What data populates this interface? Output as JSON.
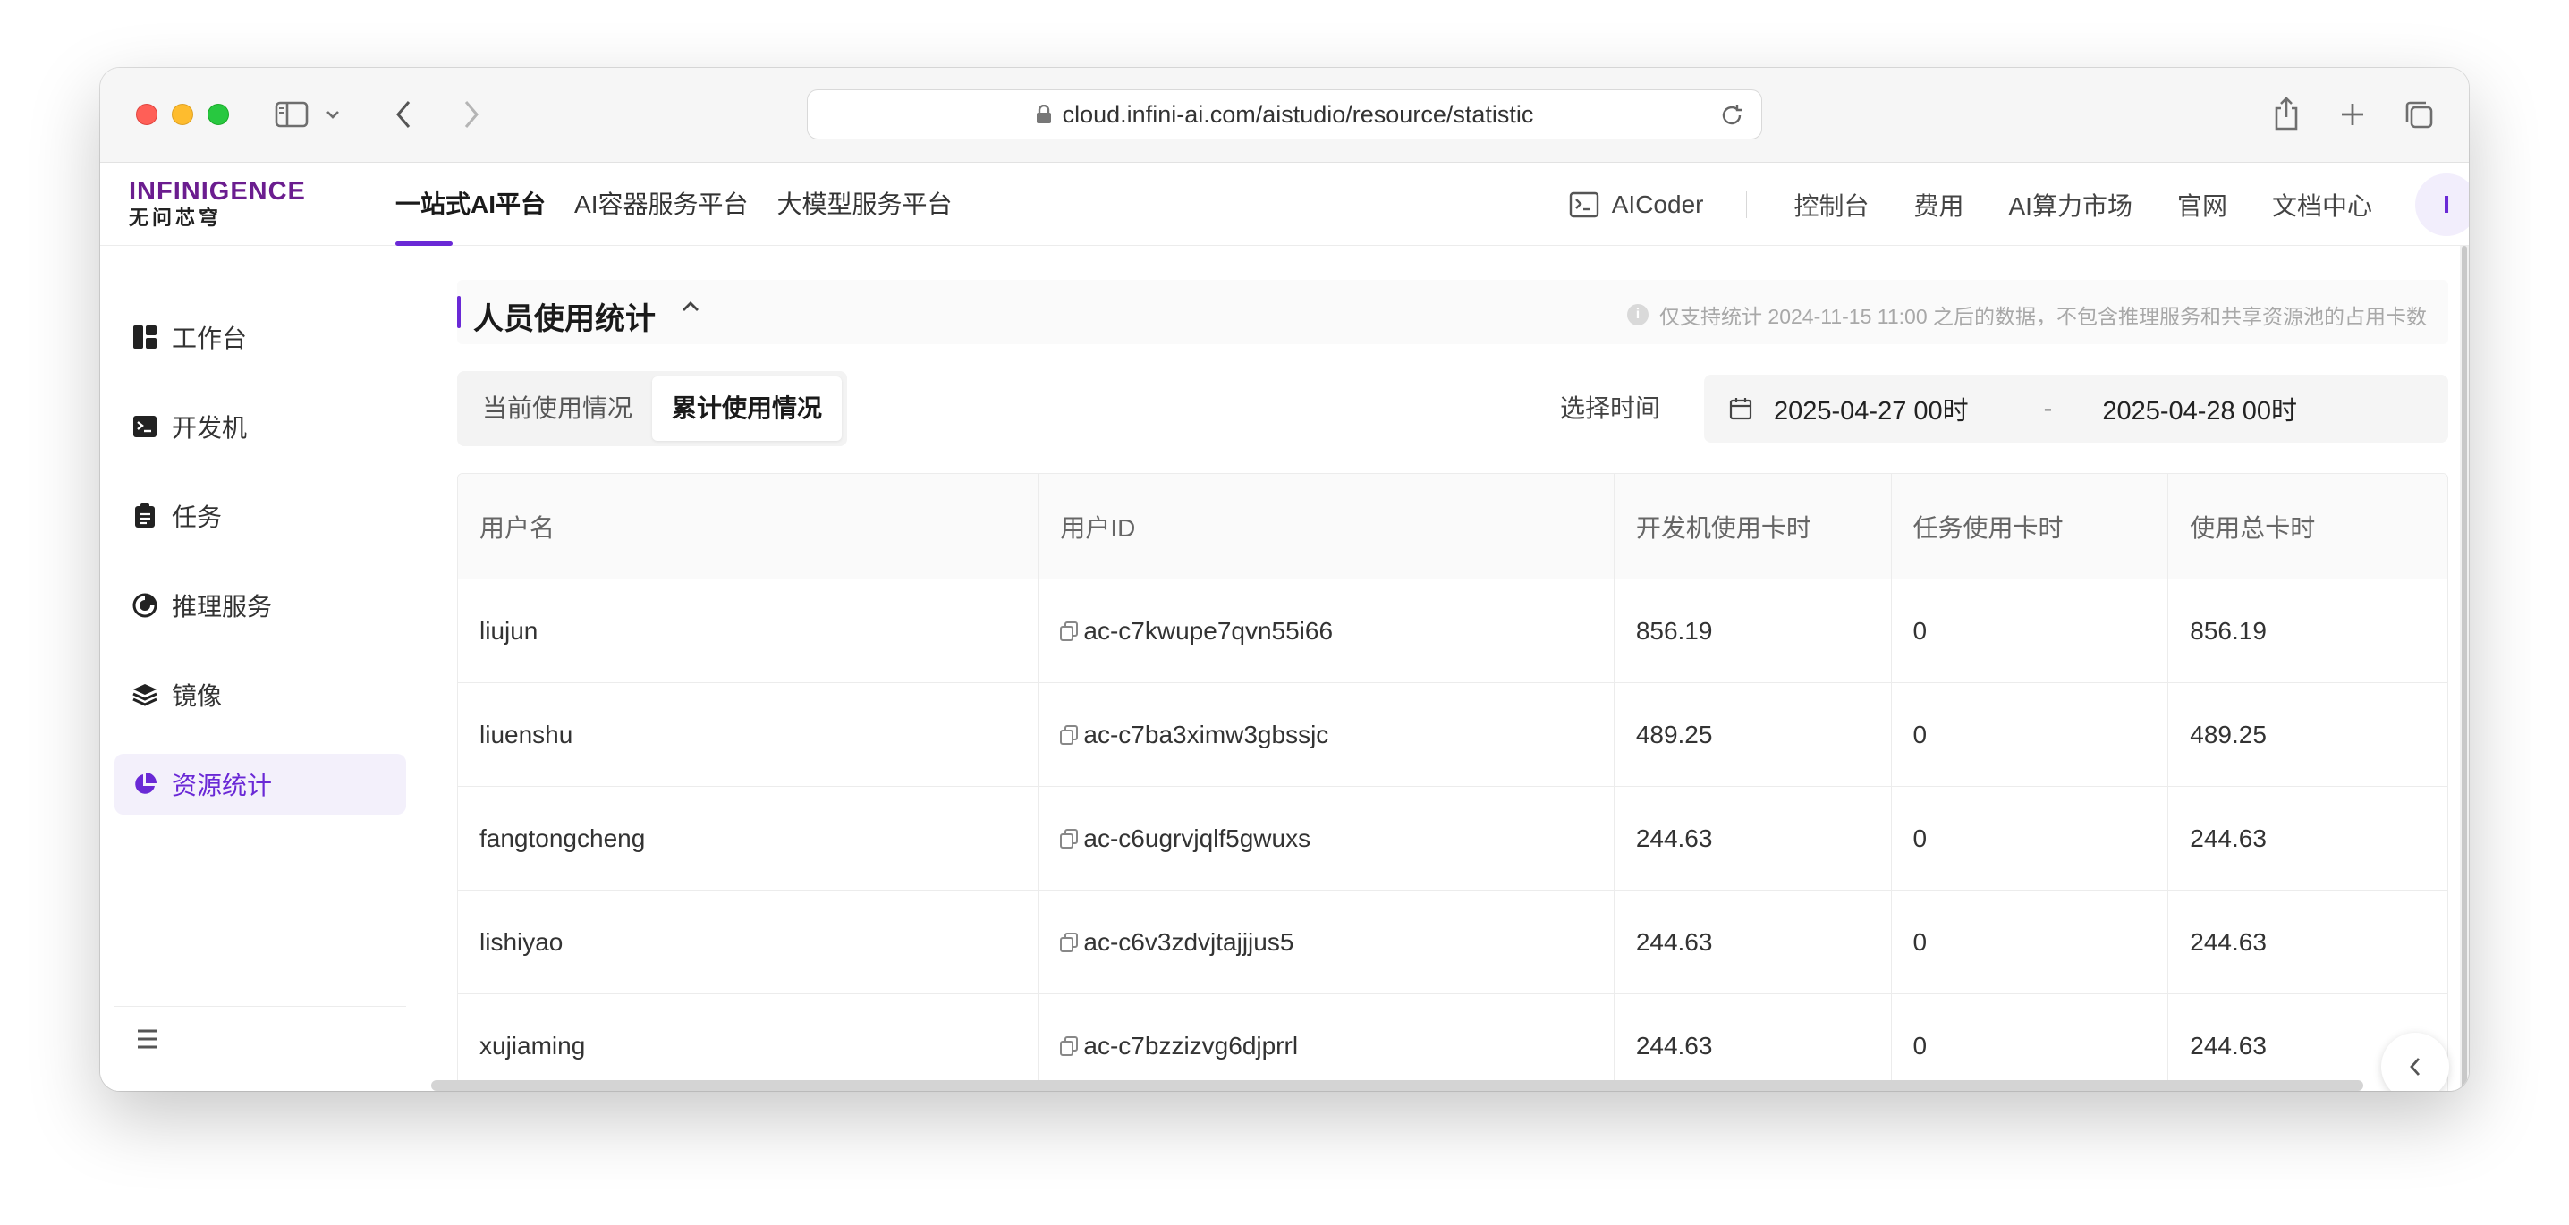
{
  "browser": {
    "url": "cloud.infini-ai.com/aistudio/resource/statistic"
  },
  "brand": {
    "logo_top": "INFINIGENCE",
    "logo_bottom": "无问芯穹",
    "accent_color": "#6a29d6"
  },
  "top_nav": {
    "main": [
      {
        "label": "一站式AI平台",
        "active": true
      },
      {
        "label": "AI容器服务平台",
        "active": false
      },
      {
        "label": "大模型服务平台",
        "active": false
      }
    ],
    "aicoder": "AICoder",
    "links": [
      "控制台",
      "费用",
      "AI算力市场",
      "官网",
      "文档中心"
    ],
    "avatar_initial": "I"
  },
  "sidebar": {
    "items": [
      {
        "label": "工作台",
        "icon": "dashboard-icon",
        "active": false
      },
      {
        "label": "开发机",
        "icon": "terminal-icon",
        "active": false
      },
      {
        "label": "任务",
        "icon": "clipboard-icon",
        "active": false
      },
      {
        "label": "推理服务",
        "icon": "inference-icon",
        "active": false
      },
      {
        "label": "镜像",
        "icon": "layers-icon",
        "active": false
      },
      {
        "label": "资源统计",
        "icon": "pie-chart-icon",
        "active": true
      }
    ]
  },
  "section": {
    "title": "人员使用统计",
    "note": "仅支持统计 2024-11-15 11:00 之后的数据，不包含推理服务和共享资源池的占用卡数"
  },
  "tabs": [
    {
      "label": "当前使用情况",
      "active": false
    },
    {
      "label": "累计使用情况",
      "active": true
    }
  ],
  "time_filter": {
    "label": "选择时间",
    "start": "2025-04-27 00时",
    "separator": "-",
    "end": "2025-04-28 00时"
  },
  "table": {
    "columns": [
      "用户名",
      "用户ID",
      "开发机使用卡时",
      "任务使用卡时",
      "使用总卡时"
    ],
    "rows": [
      [
        "liujun",
        "ac-c7kwupe7qvn55i66",
        "856.19",
        "0",
        "856.19"
      ],
      [
        "liuenshu",
        "ac-c7ba3ximw3gbssjc",
        "489.25",
        "0",
        "489.25"
      ],
      [
        "fangtongcheng",
        "ac-c6ugrvjqlf5gwuxs",
        "244.63",
        "0",
        "244.63"
      ],
      [
        "lishiyao",
        "ac-c6v3zdvjtajjjus5",
        "244.63",
        "0",
        "244.63"
      ],
      [
        "xujiaming",
        "ac-c7bzzizvg6djprrl",
        "244.63",
        "0",
        "244.63"
      ]
    ]
  }
}
